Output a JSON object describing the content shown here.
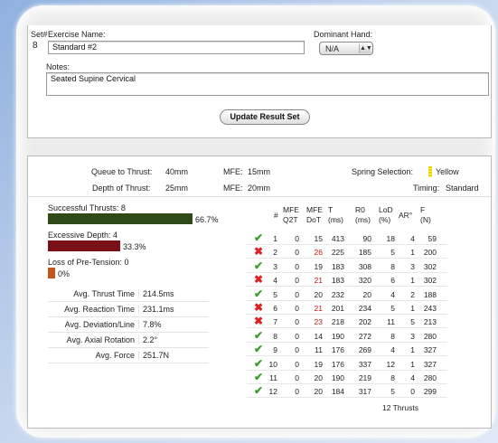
{
  "form": {
    "set_label": "Set#",
    "set_value": "8",
    "exercise_label": "Exercise Name:",
    "exercise_value": "Standard #2",
    "dominant_label": "Dominant Hand:",
    "dominant_value": "N/A",
    "notes_label": "Notes:",
    "notes_value": "Seated Supine Cervical",
    "update_button": "Update Result Set"
  },
  "params": {
    "queue_label": "Queue to Thrust:",
    "queue_value": "40mm",
    "depth_label": "Depth of Thrust:",
    "depth_value": "25mm",
    "mfe1_label": "MFE:",
    "mfe1_value": "15mm",
    "mfe2_label": "MFE:",
    "mfe2_value": "20mm",
    "spring_label": "Spring Selection:",
    "spring_value": "Yellow",
    "timing_label": "Timing:",
    "timing_value": "Standard"
  },
  "summary": {
    "successful_label": "Successful Thrusts: 8",
    "successful_pct": "66.7%",
    "successful_fraction": 0.667,
    "excessive_label": "Excessive Depth: 4",
    "excessive_pct": "33.3%",
    "excessive_fraction": 0.333,
    "loss_label": "Loss of Pre-Tension: 0",
    "loss_pct": "0%",
    "loss_fraction": 0,
    "colors": {
      "success": "#2f4a18",
      "excessive": "#7a1018",
      "loss": "#c4541c"
    }
  },
  "averages": [
    {
      "label": "Avg. Thrust Time",
      "value": "214.5ms"
    },
    {
      "label": "Avg. Reaction Time",
      "value": "231.1ms"
    },
    {
      "label": "Avg. Deviation/Line",
      "value": "7.8%"
    },
    {
      "label": "Avg. Axial Rotation",
      "value": "2.2°"
    },
    {
      "label": "Avg. Force",
      "value": "251.7N"
    }
  ],
  "table": {
    "headers": [
      {
        "top": "",
        "bottom": "#"
      },
      {
        "top": "MFE",
        "bottom": "Q2T"
      },
      {
        "top": "MFE",
        "bottom": "DoT"
      },
      {
        "top": "T",
        "bottom": "(ms)"
      },
      {
        "top": "R0",
        "bottom": "(ms)"
      },
      {
        "top": "LoD",
        "bottom": "(%)"
      },
      {
        "top": "",
        "bottom": "AR°"
      },
      {
        "top": "F",
        "bottom": "(N)"
      }
    ],
    "rows": [
      {
        "status": "check",
        "n": "1",
        "q2t": "0",
        "dot": "15",
        "t": "413",
        "r0": "90",
        "lod": "18",
        "ar": "4",
        "f": "59"
      },
      {
        "status": "x",
        "n": "2",
        "q2t": "0",
        "dot": "26",
        "t": "225",
        "r0": "185",
        "lod": "5",
        "ar": "1",
        "f": "200"
      },
      {
        "status": "check",
        "n": "3",
        "q2t": "0",
        "dot": "19",
        "t": "183",
        "r0": "308",
        "lod": "8",
        "ar": "3",
        "f": "302"
      },
      {
        "status": "x",
        "n": "4",
        "q2t": "0",
        "dot": "21",
        "t": "183",
        "r0": "320",
        "lod": "6",
        "ar": "1",
        "f": "302"
      },
      {
        "status": "check",
        "n": "5",
        "q2t": "0",
        "dot": "20",
        "t": "232",
        "r0": "20",
        "lod": "4",
        "ar": "2",
        "f": "188"
      },
      {
        "status": "x",
        "n": "6",
        "q2t": "0",
        "dot": "21",
        "t": "201",
        "r0": "234",
        "lod": "5",
        "ar": "1",
        "f": "243"
      },
      {
        "status": "x",
        "n": "7",
        "q2t": "0",
        "dot": "23",
        "t": "218",
        "r0": "202",
        "lod": "11",
        "ar": "5",
        "f": "213"
      },
      {
        "status": "check",
        "n": "8",
        "q2t": "0",
        "dot": "14",
        "t": "190",
        "r0": "272",
        "lod": "8",
        "ar": "3",
        "f": "280"
      },
      {
        "status": "check",
        "n": "9",
        "q2t": "0",
        "dot": "11",
        "t": "176",
        "r0": "269",
        "lod": "4",
        "ar": "1",
        "f": "327"
      },
      {
        "status": "check",
        "n": "10",
        "q2t": "0",
        "dot": "19",
        "t": "176",
        "r0": "337",
        "lod": "12",
        "ar": "1",
        "f": "327"
      },
      {
        "status": "check",
        "n": "11",
        "q2t": "0",
        "dot": "20",
        "t": "190",
        "r0": "219",
        "lod": "8",
        "ar": "4",
        "f": "280"
      },
      {
        "status": "check",
        "n": "12",
        "q2t": "0",
        "dot": "20",
        "t": "184",
        "r0": "317",
        "lod": "5",
        "ar": "0",
        "f": "299"
      }
    ],
    "footer": "12 Thrusts"
  }
}
